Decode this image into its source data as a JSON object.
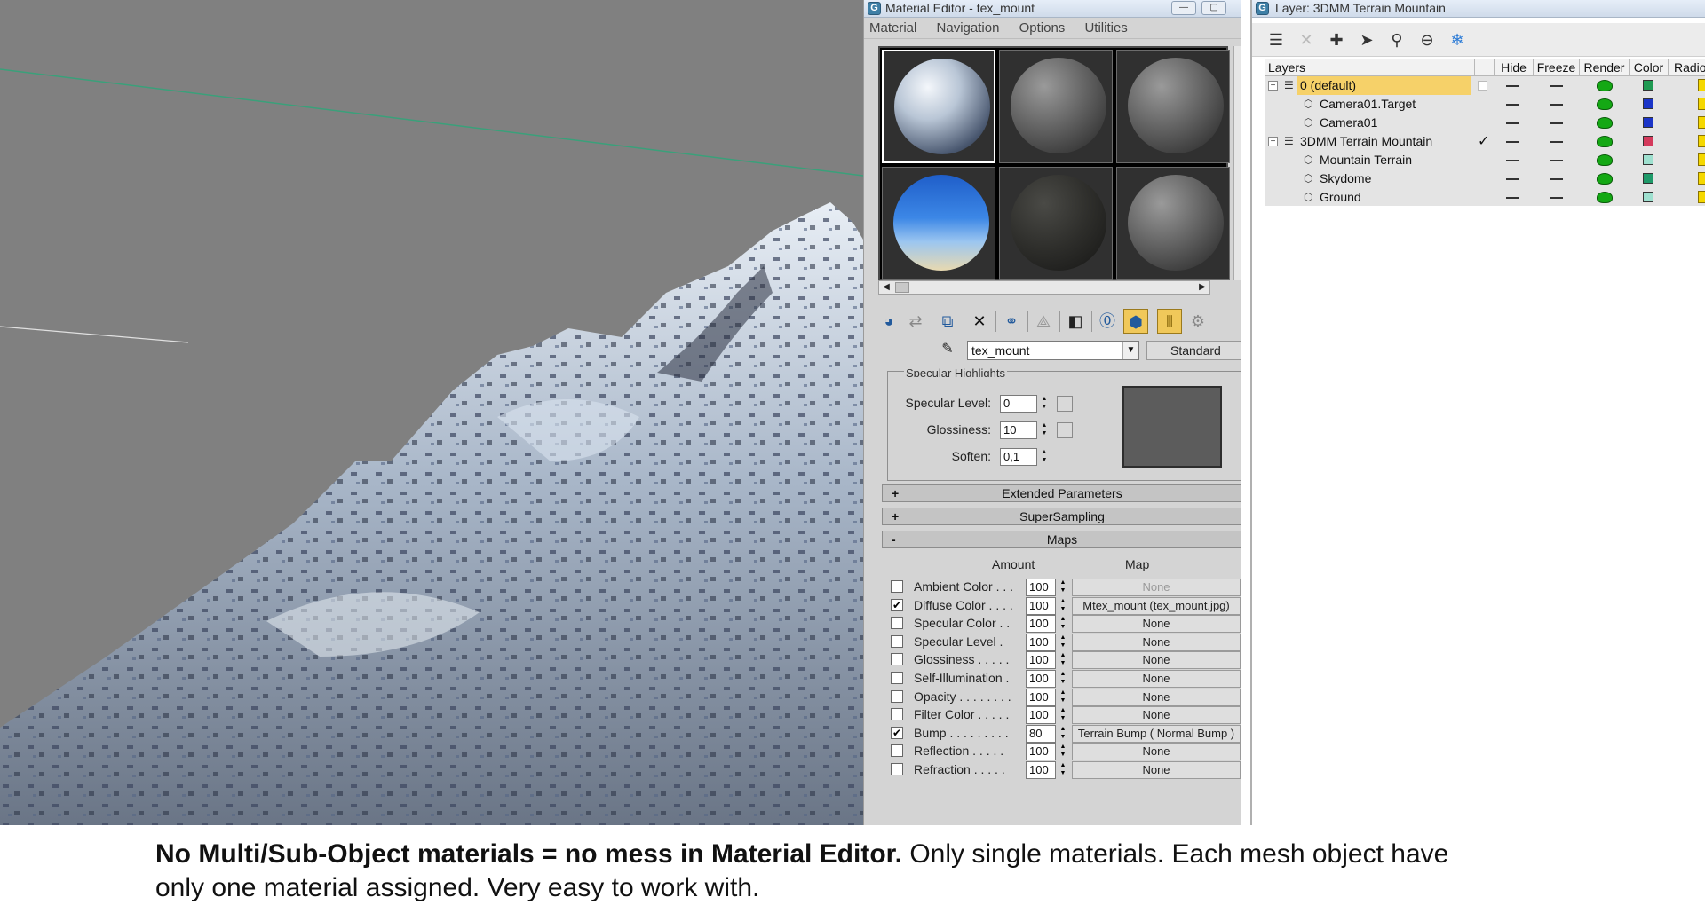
{
  "material_editor": {
    "title": "Material Editor - tex_mount",
    "menu": [
      "Material",
      "Navigation",
      "Options",
      "Utilities"
    ],
    "material_name": "tex_mount",
    "material_type": "Standard",
    "specular_group_title": "Specular Highlights",
    "params": [
      {
        "label": "Specular Level:",
        "value": "0"
      },
      {
        "label": "Glossiness:",
        "value": "10"
      },
      {
        "label": "Soften:",
        "value": "0,1"
      }
    ],
    "rollouts": {
      "extended": "Extended Parameters",
      "supersampling": "SuperSampling",
      "maps": "Maps"
    },
    "maps_header": {
      "amount": "Amount",
      "map": "Map"
    },
    "maps": [
      {
        "name": "Ambient Color . . .",
        "checked": false,
        "amount": "100",
        "map": "None",
        "disabled": true
      },
      {
        "name": "Diffuse Color . . . .",
        "checked": true,
        "amount": "100",
        "map": "Mtex_mount (tex_mount.jpg)",
        "disabled": false
      },
      {
        "name": "Specular Color  . .",
        "checked": false,
        "amount": "100",
        "map": "None",
        "disabled": false
      },
      {
        "name": "Specular Level  .",
        "checked": false,
        "amount": "100",
        "map": "None",
        "disabled": false
      },
      {
        "name": "Glossiness . . . . .",
        "checked": false,
        "amount": "100",
        "map": "None",
        "disabled": false
      },
      {
        "name": "Self-Illumination .",
        "checked": false,
        "amount": "100",
        "map": "None",
        "disabled": false
      },
      {
        "name": "Opacity . . . . . . . .",
        "checked": false,
        "amount": "100",
        "map": "None",
        "disabled": false
      },
      {
        "name": "Filter Color  . . . . .",
        "checked": false,
        "amount": "100",
        "map": "None",
        "disabled": false
      },
      {
        "name": "Bump . . . . . . . . .",
        "checked": true,
        "amount": "80",
        "map": "Terrain Bump  ( Normal Bump )",
        "disabled": false
      },
      {
        "name": "Reflection  . . . . .",
        "checked": false,
        "amount": "100",
        "map": "None",
        "disabled": false
      },
      {
        "name": "Refraction  . . . . .",
        "checked": false,
        "amount": "100",
        "map": "None",
        "disabled": false
      }
    ]
  },
  "layer_manager": {
    "title": "Layer: 3DMM Terrain Mountain",
    "columns": [
      "Layers",
      "Hide",
      "Freeze",
      "Render",
      "Color",
      "Radio"
    ],
    "rows": [
      {
        "name": "0 (default)",
        "level": 0,
        "layer": true,
        "selected": true,
        "current": false,
        "color": "#1f9a52"
      },
      {
        "name": "Camera01.Target",
        "level": 1,
        "layer": false,
        "selected": false,
        "current": false,
        "color": "#1b35c8"
      },
      {
        "name": "Camera01",
        "level": 1,
        "layer": false,
        "selected": false,
        "current": false,
        "color": "#1b35c8"
      },
      {
        "name": "3DMM Terrain Mountain",
        "level": 0,
        "layer": true,
        "selected": false,
        "current": true,
        "color": "#d43a5c"
      },
      {
        "name": "Mountain Terrain",
        "level": 1,
        "layer": false,
        "selected": false,
        "current": false,
        "color": "#9ee0cf"
      },
      {
        "name": "Skydome",
        "level": 1,
        "layer": false,
        "selected": false,
        "current": false,
        "color": "#1f9a6a"
      },
      {
        "name": "Ground",
        "level": 1,
        "layer": false,
        "selected": false,
        "current": false,
        "color": "#9ee0cf"
      }
    ]
  },
  "caption": {
    "bold": "No Multi/Sub-Object materials = no mess in Material Editor.",
    "rest1": " Only single materials. Each mesh object have",
    "line2": "only one material assigned. Very easy to work with."
  }
}
